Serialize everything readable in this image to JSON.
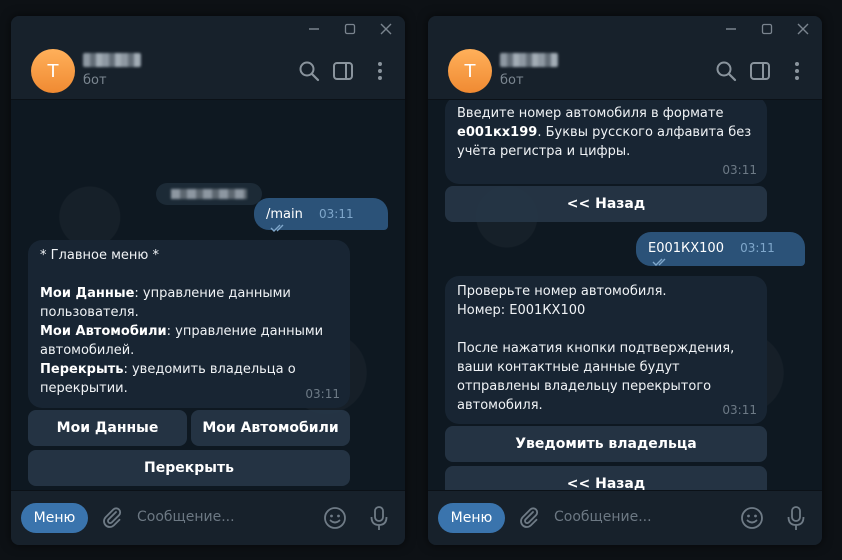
{
  "windows": [
    {
      "avatar_letter": "T",
      "subtitle": "бот",
      "date_label": "",
      "outgoing": {
        "text": "/main",
        "time": "03:11"
      },
      "message": {
        "lines": [
          {
            "pre": "* Главное меню *",
            "bold": "",
            "post": ""
          },
          {
            "pre": "",
            "bold": "",
            "post": ""
          },
          {
            "pre": "",
            "bold": "Мои Данные",
            "post": ": управление данными"
          },
          {
            "pre": "пользователя.",
            "bold": "",
            "post": ""
          },
          {
            "pre": "",
            "bold": "Мои Автомобили",
            "post": ": управление данными"
          },
          {
            "pre": "автомобилей.",
            "bold": "",
            "post": ""
          },
          {
            "pre": "",
            "bold": "Перекрыть",
            "post": ": уведомить владельца о"
          },
          {
            "pre": "перекрытии.",
            "bold": "",
            "post": ""
          }
        ],
        "time": "03:11"
      },
      "buttons": [
        "Мои Данные",
        "Мои Автомобили",
        "Перекрыть"
      ],
      "composer": {
        "menu_label": "Меню",
        "placeholder": "Сообщение..."
      }
    },
    {
      "avatar_letter": "T",
      "subtitle": "бот",
      "prev_message": {
        "lines": [
          {
            "pre": "Введите номер автомобиля в формате",
            "bold": "",
            "post": ""
          },
          {
            "pre": "",
            "bold": "е001кх199",
            "post": ". Буквы русского алфавита без"
          },
          {
            "pre": "учёта регистра и цифры.",
            "bold": "",
            "post": ""
          }
        ],
        "time": "03:11"
      },
      "back_label": "<< Назад",
      "outgoing": {
        "text": "Е001КХ100",
        "time": "03:11"
      },
      "message": {
        "lines": [
          {
            "pre": "Проверьте номер автомобиля.",
            "bold": "",
            "post": ""
          },
          {
            "pre": "Номер: Е001КХ100",
            "bold": "",
            "post": ""
          },
          {
            "pre": "",
            "bold": "",
            "post": ""
          },
          {
            "pre": "После нажатия кнопки подтверждения,",
            "bold": "",
            "post": ""
          },
          {
            "pre": "ваши контактные данные будут",
            "bold": "",
            "post": ""
          },
          {
            "pre": "отправлены владельцу перекрытого",
            "bold": "",
            "post": ""
          },
          {
            "pre": "автомобиля.",
            "bold": "",
            "post": ""
          }
        ],
        "time": "03:11"
      },
      "buttons": [
        "Уведомить владельца",
        "<< Назад"
      ],
      "composer": {
        "menu_label": "Меню",
        "placeholder": "Сообщение..."
      }
    }
  ],
  "colors": {
    "accent": "#3a74ad",
    "outgoing_bubble": "#2b5278",
    "incoming_bubble": "#182533",
    "panel": "#17212b"
  },
  "icons": [
    "minimize-icon",
    "maximize-icon",
    "close-icon",
    "search-icon",
    "sidebar-toggle-icon",
    "more-vertical-icon",
    "read-ticks-icon",
    "paperclip-icon",
    "emoji-icon",
    "microphone-icon"
  ]
}
